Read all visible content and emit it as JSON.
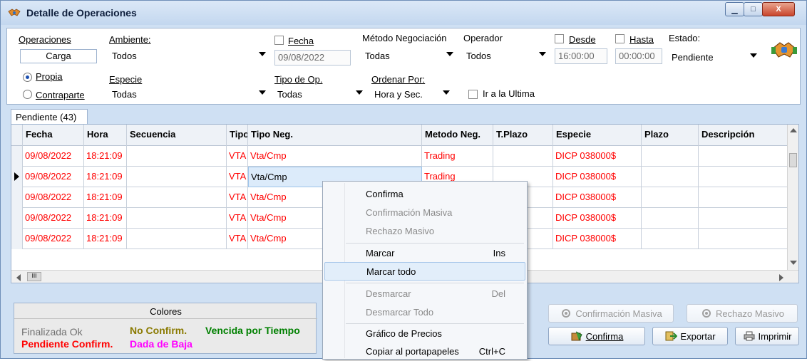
{
  "window": {
    "title": "Detalle de Operaciones",
    "minimize": "▁",
    "maximize": "□",
    "close": "X"
  },
  "filters": {
    "operaciones": "Operaciones",
    "carga": "Carga",
    "propia": "Propia",
    "contraparte": "Contraparte",
    "ambiente_label": "Ambiente:",
    "ambiente_value": "Todos",
    "fecha_label": "Fecha",
    "fecha_value": "09/08/2022",
    "metodo_label": "Método Negociación",
    "metodo_value": "Todas",
    "operador_label": "Operador",
    "operador_value": "Todos",
    "desde_label": "Desde",
    "desde_value": "16:00:00",
    "hasta_label": "Hasta",
    "hasta_value": "00:00:00",
    "estado_label": "Estado:",
    "estado_value": "Pendiente",
    "especie_label": "Especie",
    "especie_value": "Todas",
    "tipoop_label": "Tipo de Op.",
    "tipoop_value": "Todas",
    "ordenar_label": "Ordenar Por:",
    "ordenar_value": "Hora y Sec.",
    "ultima_label": "Ir a la Ultima"
  },
  "tab": {
    "label": "Pendiente (43)"
  },
  "grid": {
    "columns": [
      "Fecha",
      "Hora",
      "Secuencia",
      "Tipo",
      "Tipo Neg.",
      "Metodo Neg.",
      "T.Plazo",
      "Especie",
      "Plazo",
      "Descripción"
    ],
    "rows": [
      [
        "09/08/2022",
        "18:21:09",
        "",
        "VTA",
        "Vta/Cmp",
        "Trading",
        "",
        "DICP  038000$",
        "",
        ""
      ],
      [
        "09/08/2022",
        "18:21:09",
        "",
        "VTA",
        "Vta/Cmp",
        "Trading",
        "",
        "DICP  038000$",
        "",
        ""
      ],
      [
        "09/08/2022",
        "18:21:09",
        "",
        "VTA",
        "Vta/Cmp",
        "",
        "",
        "DICP  038000$",
        "",
        ""
      ],
      [
        "09/08/2022",
        "18:21:09",
        "",
        "VTA",
        "Vta/Cmp",
        "",
        "",
        "DICP  038000$",
        "",
        ""
      ],
      [
        "09/08/2022",
        "18:21:09",
        "",
        "VTA",
        "Vta/Cmp",
        "",
        "",
        "DICP  038000$",
        "",
        ""
      ]
    ],
    "hscroll_thumb": "III"
  },
  "legend": {
    "title": "Colores",
    "finalizada": "Finalizada Ok",
    "no_confirm": "No Confirm.",
    "vencida": "Vencida por Tiempo",
    "pendiente": "Pendiente Confirm.",
    "dada_baja": "Dada de Baja"
  },
  "buttons": {
    "confirmacion_masiva": "Confirmación Masiva",
    "rechazo_masivo": "Rechazo Masivo",
    "confirma": "Confirma",
    "exportar": "Exportar",
    "imprimir": "Imprimir"
  },
  "context_menu": {
    "items": [
      {
        "label": "Confirma",
        "shortcut": ""
      },
      {
        "label": "Confirmación Masiva",
        "shortcut": ""
      },
      {
        "label": "Rechazo Masivo",
        "shortcut": ""
      },
      {
        "label": "Marcar",
        "shortcut": "Ins"
      },
      {
        "label": "Marcar todo",
        "shortcut": ""
      },
      {
        "label": "Desmarcar",
        "shortcut": "Del"
      },
      {
        "label": "Desmarcar Todo",
        "shortcut": ""
      },
      {
        "label": "Gráfico de Precios",
        "shortcut": ""
      },
      {
        "label": "Copiar al portapapeles",
        "shortcut": "Ctrl+C"
      }
    ]
  },
  "colors": {
    "pendiente_red": "#ff0000",
    "no_confirm_olive": "#8a7a00",
    "vencida_green": "#008000",
    "dada_baja_magenta": "#ff00ff",
    "finalizada_gray": "#707070"
  }
}
